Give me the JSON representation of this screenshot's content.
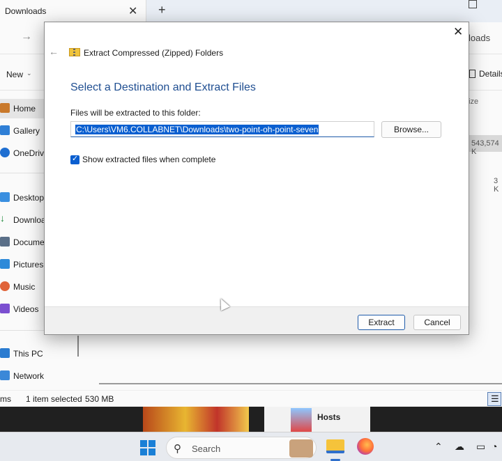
{
  "explorer": {
    "tab_title": "Downloads",
    "tab_close": "✕",
    "tab_add": "+",
    "address_partial": "loads",
    "new_label": "New",
    "details_label": "Details",
    "column_partial": "ize",
    "row_size_1": "543,574 K",
    "row_size_2": "3 K",
    "sidebar": [
      {
        "label": "Home",
        "icon": "home-icon",
        "active": true
      },
      {
        "label": "Gallery",
        "icon": "gallery-icon"
      },
      {
        "label": "OneDrive",
        "icon": "onedrive-icon"
      },
      {
        "label": "Desktop",
        "icon": "desktop-icon"
      },
      {
        "label": "Downloads",
        "icon": "download-icon"
      },
      {
        "label": "Documents",
        "icon": "documents-icon"
      },
      {
        "label": "Pictures",
        "icon": "pictures-icon"
      },
      {
        "label": "Music",
        "icon": "music-icon"
      },
      {
        "label": "Videos",
        "icon": "videos-icon"
      },
      {
        "label": "This PC",
        "icon": "this-pc-icon"
      },
      {
        "label": "Network",
        "icon": "network-icon"
      }
    ],
    "status": {
      "items_partial": "ms",
      "selected": "1 item selected",
      "size": "530 MB"
    }
  },
  "dialog": {
    "window_title": "Extract Compressed (Zipped) Folders",
    "heading": "Select a Destination and Extract Files",
    "path_label": "Files will be extracted to this folder:",
    "path_value": "C:\\Users\\VM6.COLLABNET\\Downloads\\two-point-oh-point-seven",
    "browse_label": "Browse...",
    "show_files_label": "Show extracted files when complete",
    "show_files_checked": true,
    "extract_label": "Extract",
    "cancel_label": "Cancel",
    "close_glyph": "✕",
    "back_glyph": "←"
  },
  "thumbnail": {
    "text": "Hosts"
  },
  "taskbar": {
    "search_placeholder": "Search",
    "accent": "#1a7fd6"
  }
}
